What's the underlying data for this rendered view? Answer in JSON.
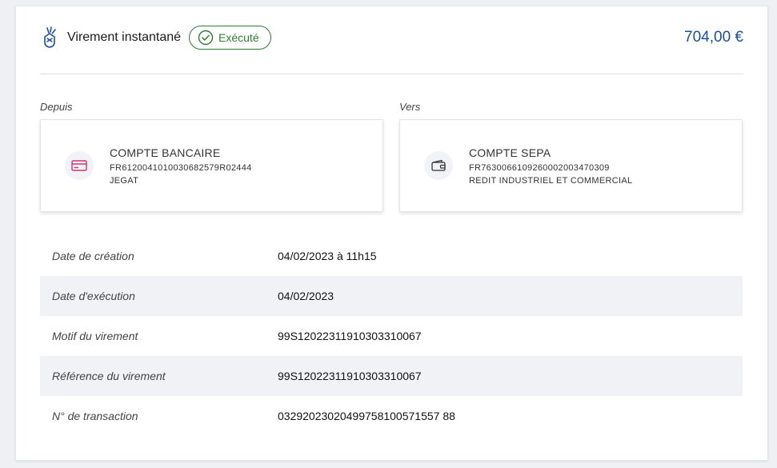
{
  "transfer": {
    "type_label": "Virement instantané",
    "status": "Exécuté",
    "amount": "704,00 €"
  },
  "from": {
    "section_label": "Depuis",
    "account_name": "COMPTE BANCAIRE",
    "iban": "FR6120041010030682579R02444",
    "holder": "JEGAT",
    "icon": "credit-card-icon"
  },
  "to": {
    "section_label": "Vers",
    "account_name": "COMPTE SEPA",
    "iban": "FR7630066109260002003470309",
    "holder": "REDIT INDUSTRIEL ET COMMERCIAL",
    "icon": "wallet-icon"
  },
  "details": [
    {
      "label": "Date de création",
      "value": "04/02/2023 à 11h15"
    },
    {
      "label": "Date d'exécution",
      "value": "04/02/2023"
    },
    {
      "label": "Motif du virement",
      "value": "99S12022311910303310067"
    },
    {
      "label": "Référence du virement",
      "value": "99S12022311910303310067"
    },
    {
      "label": "N° de transaction",
      "value": "03292023020499758100571557 88"
    }
  ],
  "colors": {
    "accent": "#1a4e9e",
    "success": "#2e7d32",
    "card_icon": "#d6336c",
    "alt_row": "#f0f2f6"
  }
}
